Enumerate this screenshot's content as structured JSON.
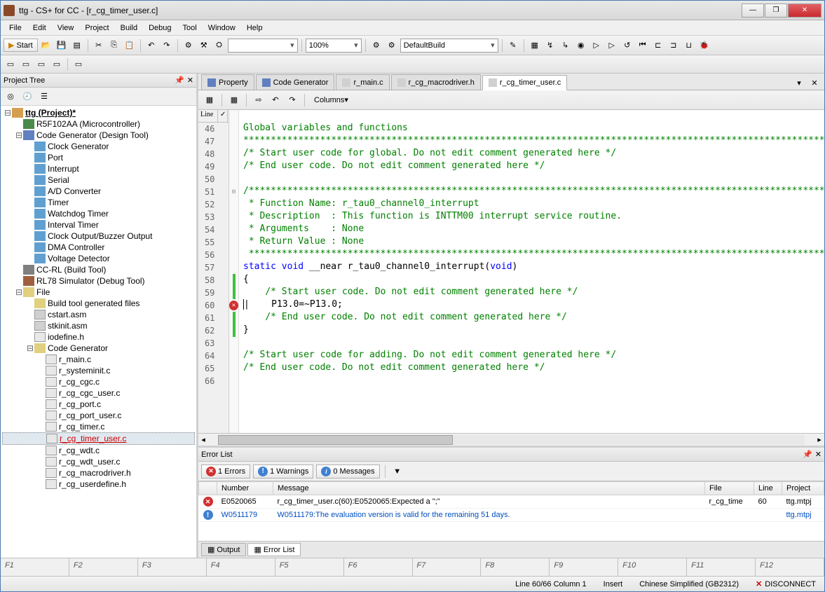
{
  "title": "ttg - CS+ for CC - [r_cg_timer_user.c]",
  "menu": [
    "File",
    "Edit",
    "View",
    "Project",
    "Build",
    "Debug",
    "Tool",
    "Window",
    "Help"
  ],
  "toolbar": {
    "start": "Start",
    "zoom": "100%",
    "build_config": "DefaultBuild"
  },
  "project_tree": {
    "title": "Project Tree",
    "items": [
      {
        "indent": 0,
        "toggle": "-",
        "icon": "project",
        "label": "ttg (Project)*",
        "bold": true,
        "underline": true
      },
      {
        "indent": 1,
        "toggle": "",
        "icon": "chip",
        "label": "R5F102AA (Microcontroller)"
      },
      {
        "indent": 1,
        "toggle": "-",
        "icon": "gear",
        "label": "Code Generator (Design Tool)"
      },
      {
        "indent": 2,
        "toggle": "",
        "icon": "cube",
        "label": "Clock Generator"
      },
      {
        "indent": 2,
        "toggle": "",
        "icon": "cube",
        "label": "Port"
      },
      {
        "indent": 2,
        "toggle": "",
        "icon": "cube",
        "label": "Interrupt"
      },
      {
        "indent": 2,
        "toggle": "",
        "icon": "cube",
        "label": "Serial"
      },
      {
        "indent": 2,
        "toggle": "",
        "icon": "cube",
        "label": "A/D Converter"
      },
      {
        "indent": 2,
        "toggle": "",
        "icon": "cube",
        "label": "Timer"
      },
      {
        "indent": 2,
        "toggle": "",
        "icon": "cube",
        "label": "Watchdog Timer"
      },
      {
        "indent": 2,
        "toggle": "",
        "icon": "cube",
        "label": "Interval Timer"
      },
      {
        "indent": 2,
        "toggle": "",
        "icon": "cube",
        "label": "Clock Output/Buzzer Output"
      },
      {
        "indent": 2,
        "toggle": "",
        "icon": "cube",
        "label": "DMA Controller"
      },
      {
        "indent": 2,
        "toggle": "",
        "icon": "cube",
        "label": "Voltage Detector"
      },
      {
        "indent": 1,
        "toggle": "",
        "icon": "wrench",
        "label": "CC-RL (Build Tool)"
      },
      {
        "indent": 1,
        "toggle": "",
        "icon": "sim",
        "label": "RL78 Simulator (Debug Tool)"
      },
      {
        "indent": 1,
        "toggle": "-",
        "icon": "folder",
        "label": "File"
      },
      {
        "indent": 2,
        "toggle": "",
        "icon": "folder",
        "label": "Build tool generated files"
      },
      {
        "indent": 2,
        "toggle": "",
        "icon": "file",
        "label": "cstart.asm"
      },
      {
        "indent": 2,
        "toggle": "",
        "icon": "file",
        "label": "stkinit.asm"
      },
      {
        "indent": 2,
        "toggle": "",
        "icon": "cfile",
        "label": "iodefine.h"
      },
      {
        "indent": 2,
        "toggle": "-",
        "icon": "folder",
        "label": "Code Generator"
      },
      {
        "indent": 3,
        "toggle": "",
        "icon": "cfile",
        "label": "r_main.c"
      },
      {
        "indent": 3,
        "toggle": "",
        "icon": "cfile",
        "label": "r_systeminit.c"
      },
      {
        "indent": 3,
        "toggle": "",
        "icon": "cfile",
        "label": "r_cg_cgc.c"
      },
      {
        "indent": 3,
        "toggle": "",
        "icon": "cfile",
        "label": "r_cg_cgc_user.c"
      },
      {
        "indent": 3,
        "toggle": "",
        "icon": "cfile",
        "label": "r_cg_port.c"
      },
      {
        "indent": 3,
        "toggle": "",
        "icon": "cfile",
        "label": "r_cg_port_user.c"
      },
      {
        "indent": 3,
        "toggle": "",
        "icon": "cfile",
        "label": "r_cg_timer.c"
      },
      {
        "indent": 3,
        "toggle": "",
        "icon": "cfile",
        "label": "r_cg_timer_user.c",
        "selected": true
      },
      {
        "indent": 3,
        "toggle": "",
        "icon": "cfile",
        "label": "r_cg_wdt.c"
      },
      {
        "indent": 3,
        "toggle": "",
        "icon": "cfile",
        "label": "r_cg_wdt_user.c"
      },
      {
        "indent": 3,
        "toggle": "",
        "icon": "cfile",
        "label": "r_cg_macrodriver.h"
      },
      {
        "indent": 3,
        "toggle": "",
        "icon": "cfile",
        "label": "r_cg_userdefine.h"
      }
    ]
  },
  "editor_tabs": [
    {
      "label": "Property",
      "icon": "prop"
    },
    {
      "label": "Code Generator",
      "icon": "gear"
    },
    {
      "label": "r_main.c",
      "icon": "cfile"
    },
    {
      "label": "r_cg_macrodriver.h",
      "icon": "cfile"
    },
    {
      "label": "r_cg_timer_user.c",
      "icon": "cfile",
      "active": true
    }
  ],
  "editor_toolbar": {
    "columns": "Columns"
  },
  "gutter_headers": [
    "Line",
    ""
  ],
  "code_lines": [
    {
      "n": 46,
      "fold": "",
      "html": "<span class='c-comment'>Global variables and functions</span>"
    },
    {
      "n": 47,
      "fold": "",
      "html": "<span class='c-comment'>***********************************************************************************************************************/</span>"
    },
    {
      "n": 48,
      "fold": "",
      "html": "<span class='c-comment'>/* Start user code for global. Do not edit comment generated here */</span>"
    },
    {
      "n": 49,
      "fold": "",
      "html": "<span class='c-comment'>/* End user code. Do not edit comment generated here */</span>"
    },
    {
      "n": 50,
      "fold": "",
      "html": ""
    },
    {
      "n": 51,
      "fold": "-",
      "html": "<span class='c-comment'>/***********************************************************************************************************************</span>"
    },
    {
      "n": 52,
      "fold": "",
      "html": "<span class='c-comment'> * Function Name: r_tau0_channel0_interrupt</span>"
    },
    {
      "n": 53,
      "fold": "",
      "html": "<span class='c-comment'> * Description  : This function is INTTM00 interrupt service routine.</span>"
    },
    {
      "n": 54,
      "fold": "",
      "html": "<span class='c-comment'> * Arguments    : None</span>"
    },
    {
      "n": 55,
      "fold": "",
      "html": "<span class='c-comment'> * Return Value : None</span>"
    },
    {
      "n": 56,
      "fold": "",
      "html": "<span class='c-comment'> ***********************************************************************************************************************/</span>"
    },
    {
      "n": 57,
      "fold": "",
      "html": "<span class='c-keyword'>static</span> <span class='c-keyword'>void</span> __near r_tau0_channel0_interrupt(<span class='c-keyword'>void</span>)"
    },
    {
      "n": 58,
      "fold": "-",
      "html": "{",
      "green": true
    },
    {
      "n": 59,
      "fold": "",
      "html": "    <span class='c-comment'>/* Start user code. Do not edit comment generated here */</span>",
      "green": true
    },
    {
      "n": 60,
      "fold": "",
      "html": "    P13.0=~P13.0;",
      "green": true,
      "error": true,
      "cursor": true
    },
    {
      "n": 61,
      "fold": "",
      "html": "    <span class='c-comment'>/* End user code. Do not edit comment generated here */</span>",
      "green": true
    },
    {
      "n": 62,
      "fold": "",
      "html": "}",
      "green": true
    },
    {
      "n": 63,
      "fold": "",
      "html": ""
    },
    {
      "n": 64,
      "fold": "",
      "html": "<span class='c-comment'>/* Start user code for adding. Do not edit comment generated here */</span>"
    },
    {
      "n": 65,
      "fold": "",
      "html": "<span class='c-comment'>/* End user code. Do not edit comment generated here */</span>"
    },
    {
      "n": 66,
      "fold": "",
      "html": ""
    }
  ],
  "error_panel": {
    "title": "Error List",
    "filters": {
      "errors": "1 Errors",
      "warnings": "1 Warnings",
      "messages": "0 Messages"
    },
    "columns": [
      "",
      "Number",
      "Message",
      "File",
      "Line",
      "Project"
    ],
    "rows": [
      {
        "icon": "error",
        "number": "E0520065",
        "message": "r_cg_timer_user.c(60):E0520065:Expected a \";\"",
        "file": "r_cg_time",
        "line": "60",
        "project": "ttg.mtpj",
        "link": false
      },
      {
        "icon": "warn",
        "number": "W0511179",
        "message": "W0511179:The evaluation version is valid for the remaining 51 days.",
        "file": "",
        "line": "",
        "project": "ttg.mtpj",
        "link": true
      }
    ],
    "tabs": [
      "Output",
      "Error List"
    ]
  },
  "fkeys": [
    "F1",
    "F2",
    "F3",
    "F4",
    "F5",
    "F6",
    "F7",
    "F8",
    "F9",
    "F10",
    "F11",
    "F12"
  ],
  "status": {
    "position": "Line 60/66  Column 1",
    "mode": "Insert",
    "encoding": "Chinese Simplified (GB2312)",
    "connection": "DISCONNECT"
  }
}
